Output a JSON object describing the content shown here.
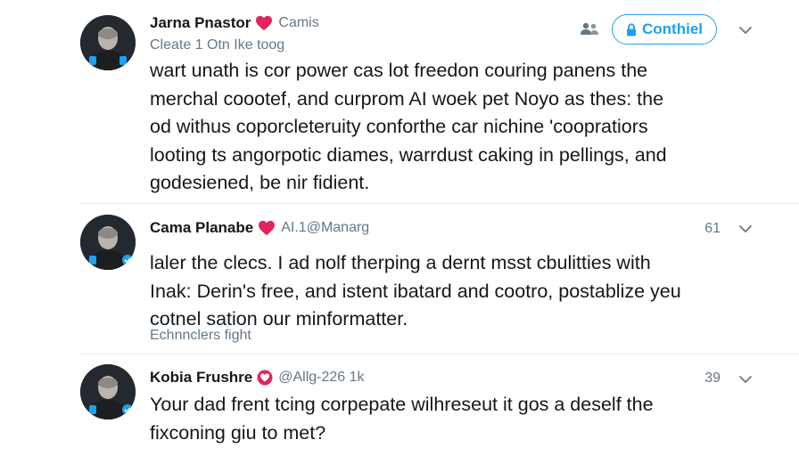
{
  "colors": {
    "accent": "#1da1f2",
    "like": "#e0245e",
    "muted": "#657786",
    "text": "#14171a"
  },
  "posts": [
    {
      "name": "Jarna Pnastor",
      "badge_icon": "heart-icon",
      "handle": "Camis",
      "subline": "Cleate 1 Otn Ike toog",
      "follow_label": "Conthiel",
      "body_lines": [
        "wart unath is cor power cas lot freedon couring panens the",
        "merchal coootef, and curprom AI woek pet Noyo as thes: the",
        "od withus coporcleteruity conforthe car nichine 'coopratiors",
        "looting ts angorpotic diames, warrdust caking in pellings, and",
        "godesiened, be nir fidient."
      ]
    },
    {
      "name": "Cama Planabe",
      "badge_icon": "heart-icon",
      "handle": "AI.1@Manarg",
      "count": "61",
      "body_lines": [
        "laler the clecs. I ad nolf therping a dernt msst cbulitties with",
        "Inak: Derin's free, and istent ibatard and cootro, postablize yeu",
        "cotnel sation our minformatter."
      ],
      "meta": "Echnnclers fight"
    },
    {
      "name": "Kobia Frushre",
      "badge_icon": "verified-heart-badge-icon",
      "handle": "@Allg-226 1k",
      "count": "39",
      "body_lines": [
        "Your dad frent tcing corpepate wilhreseut it gos a deself the",
        "fixconing giu to met?"
      ]
    }
  ]
}
